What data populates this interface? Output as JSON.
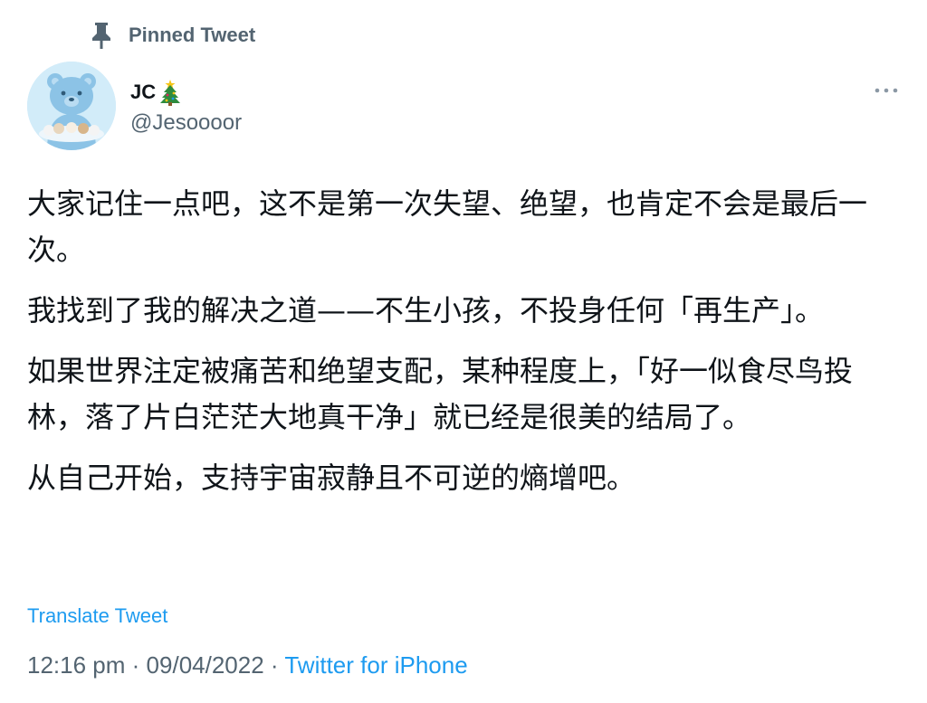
{
  "pinned": {
    "label": "Pinned Tweet",
    "icon": "pin-icon"
  },
  "user": {
    "display_name": "JC",
    "name_emoji": "christmas-tree-icon",
    "handle": "@Jesoooor",
    "avatar_icon": "bear-avatar"
  },
  "tweet": {
    "paragraphs": [
      "大家记住一点吧，这不是第一次失望、绝望，也肯定不会是最后一次。",
      "我找到了我的解决之道——不生小孩，不投身任何「再生产」。",
      "如果世界注定被痛苦和绝望支配，某种程度上，「好一似食尽鸟投林，落了片白茫茫大地真干净」就已经是很美的结局了。",
      "从自己开始，支持宇宙寂静且不可逆的熵增吧。"
    ]
  },
  "translate_label": "Translate Tweet",
  "meta": {
    "time": "12:16 pm",
    "date": "09/04/2022",
    "separator": "·",
    "source": "Twitter for iPhone"
  },
  "colors": {
    "accent": "#1d9bf0",
    "secondary_text": "#536471",
    "primary_text": "#0f1419"
  }
}
